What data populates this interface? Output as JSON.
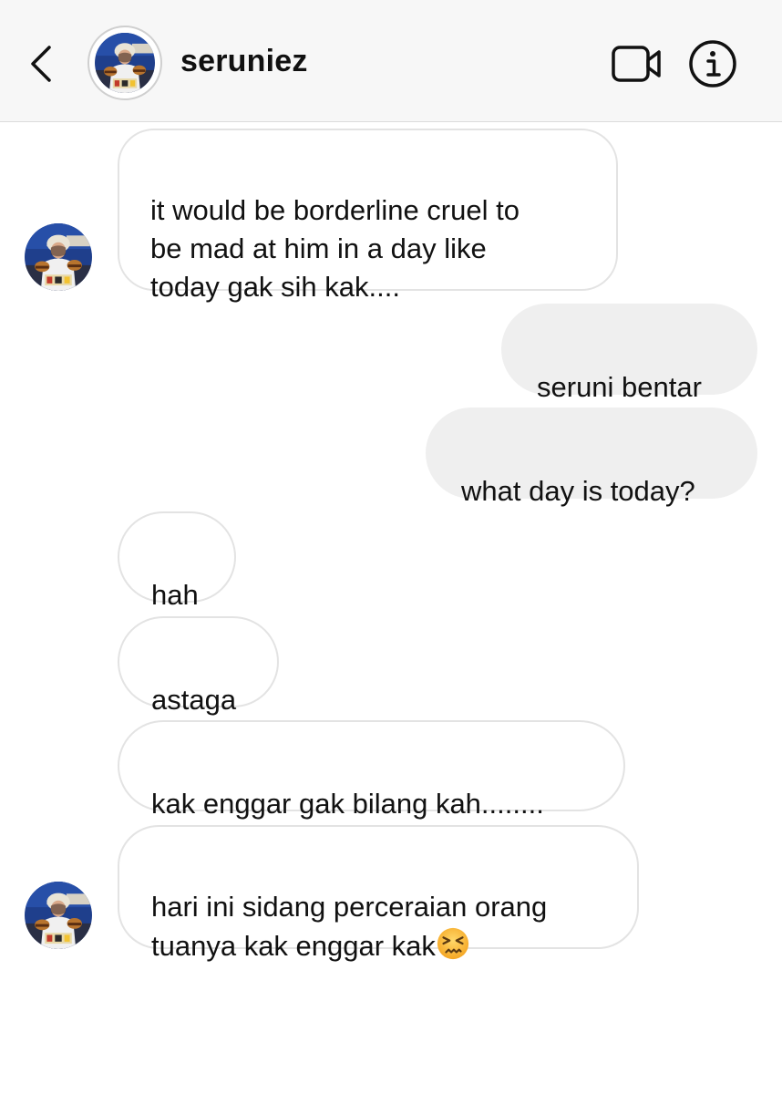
{
  "header": {
    "username": "seruniez",
    "back_icon": "chevron-left-icon",
    "video_icon": "video-camera-icon",
    "info_icon": "info-icon"
  },
  "colors": {
    "header_bg": "#f7f7f7",
    "incoming_bubble_bg": "#ffffff",
    "incoming_bubble_border": "#e3e3e3",
    "outgoing_bubble_bg": "#efefef",
    "text": "#111111"
  },
  "messages": [
    {
      "direction": "incoming",
      "text": "it would be borderline cruel to\nbe mad at him in a day like\ntoday gak sih kak...."
    },
    {
      "direction": "outgoing",
      "text": "seruni bentar"
    },
    {
      "direction": "outgoing",
      "text": "what day is today?"
    },
    {
      "direction": "incoming",
      "text": "hah"
    },
    {
      "direction": "incoming",
      "text": "astaga"
    },
    {
      "direction": "incoming",
      "text": "kak enggar gak bilang kah........"
    },
    {
      "direction": "incoming",
      "text": "hari ini sidang perceraian orang\ntuanya kak enggar kak",
      "emoji": "persevering-face"
    }
  ]
}
